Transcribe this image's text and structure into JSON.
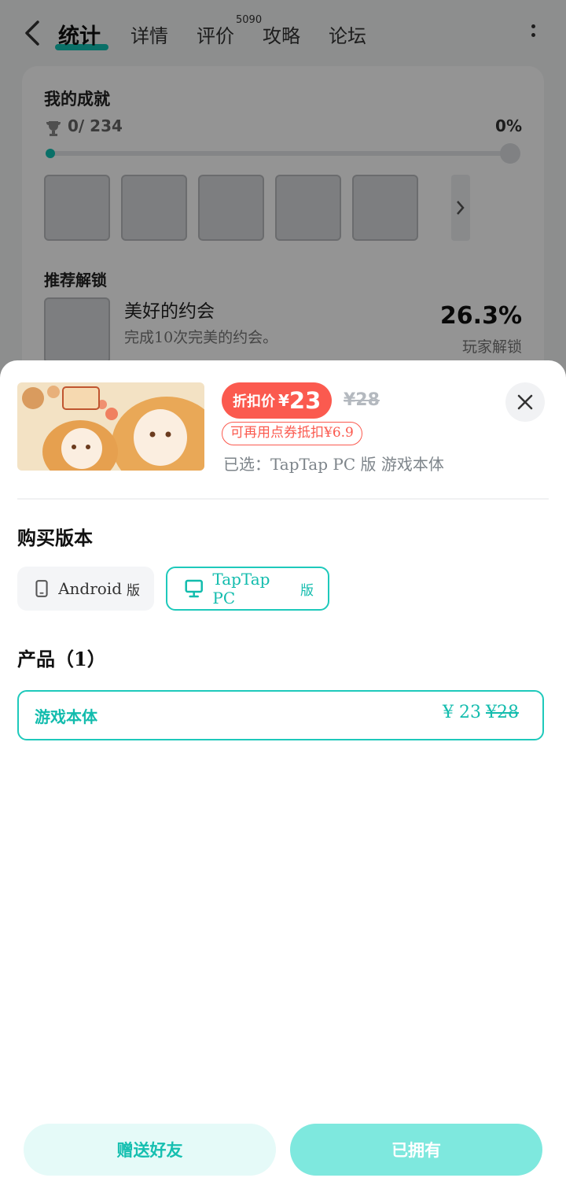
{
  "nav": {
    "tabs": [
      {
        "label": "统计",
        "active": true
      },
      {
        "label": "详情"
      },
      {
        "label": "评价",
        "badge": "5090"
      },
      {
        "label": "攻略"
      },
      {
        "label": "论坛"
      }
    ]
  },
  "achievements": {
    "title": "我的成就",
    "count": "0/ 234",
    "percent": "0%",
    "progress_fraction": 0.0,
    "recommend_title": "推荐解锁",
    "recommended": {
      "name": "美好的约会",
      "description": "完成10次完美的约会。",
      "unlock_rate": "26.3%",
      "unlock_label": "玩家解锁"
    }
  },
  "sheet": {
    "discount_label": "折扣价",
    "currency": "¥",
    "price": "23",
    "original_price": "¥28",
    "coupon_text": "可再用点券抵扣¥6.9",
    "selected_text": "已选：TapTap PC 版 游戏本体",
    "version_section_title": "购买版本",
    "versions": [
      {
        "label": "Android",
        "suffix": "版",
        "icon": "phone-icon",
        "selected": false
      },
      {
        "label": "TapTap PC",
        "suffix": "版",
        "icon": "monitor-icon",
        "selected": true
      }
    ],
    "product_section_title": "产品（1）",
    "product": {
      "name": "游戏本体",
      "price": "¥ 23",
      "original_price": "¥28"
    },
    "gift_button": "赠送好友",
    "owned_button": "已拥有"
  },
  "colors": {
    "accent": "#12c1b3",
    "discount_red": "#fb5a4f",
    "owned_button_bg": "#7ee8de"
  }
}
